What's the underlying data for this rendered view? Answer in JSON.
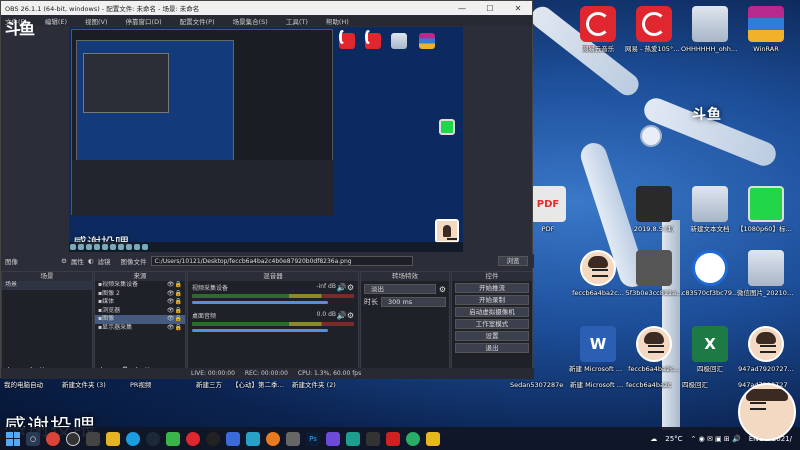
{
  "obs": {
    "title": "OBS 26.1.1 (64-bit, windows) - 配置文件: 未命名 - 场景: 未命名",
    "menu": [
      "文件(F)",
      "编辑(E)",
      "视图(V)",
      "停靠窗口(D)",
      "配置文件(P)",
      "场景集合(S)",
      "工具(T)",
      "帮助(H)"
    ],
    "logo": "斗鱼",
    "preview_caption": "感谢投喂",
    "source_toolbar": {
      "label": "图像",
      "properties": "属性",
      "filters": "滤镜",
      "image_file_label": "图像文件",
      "path": "C:/Users/10121/Desktop/feccb6a4ba2c4b0e87920b0df8236a.png",
      "browse": "浏览"
    },
    "scenes": {
      "title": "场景",
      "items": [
        "场景"
      ]
    },
    "sources": {
      "title": "来源",
      "items": [
        "视频采集设备",
        "图像 2",
        "媒体",
        "浏览器",
        "图像",
        "显示器采集"
      ],
      "selected": 4
    },
    "mixer": {
      "title": "混音器",
      "channels": [
        {
          "name": "视频采集设备",
          "db": "-inf dB"
        },
        {
          "name": "桌面音频",
          "db": "0.0 dB"
        }
      ]
    },
    "transitions": {
      "title": "转场特效",
      "current": "淡出",
      "duration_label": "时长",
      "duration": "300 ms"
    },
    "controls": {
      "title": "控件",
      "buttons": [
        "开始推流",
        "开始录制",
        "启动虚拟摄像机",
        "工作室模式",
        "设置",
        "退出"
      ]
    },
    "status": {
      "live": "LIVE: 00:00:00",
      "rec": "REC: 00:00:00",
      "cpu": "CPU: 1.3%, 60.00 fps"
    }
  },
  "desktop": {
    "wallpaper_text_left": "感谢投喂",
    "wallpaper_logo": "斗鱼",
    "icons": [
      {
        "label": "网易云音乐",
        "kind": "netease"
      },
      {
        "label": "网易 - 热爱105°C的你",
        "kind": "netease"
      },
      {
        "label": "OHHHHHH_ohhh绿幕素材(附教程)",
        "kind": "anime"
      },
      {
        "label": "WinRAR",
        "kind": "rar"
      },
      {
        "label": "PDF",
        "kind": "pdf"
      },
      {
        "label": "2019.8.5 (1)",
        "kind": "game"
      },
      {
        "label": "新建文本文档",
        "kind": "anime"
      },
      {
        "label": "【1080p60】标准绿幕素材免费用!",
        "kind": "green-vid"
      },
      {
        "label": "feccb6a4ba2c...",
        "kind": "avatar"
      },
      {
        "label": "5f3b0e3cc811a...",
        "kind": "cs"
      },
      {
        "label": "c83570cf3bc79...",
        "kind": "circle-logo"
      },
      {
        "label": "微信图片_20210722114...",
        "kind": "anime"
      },
      {
        "label": "新建 Microsoft Word 文档",
        "kind": "word"
      },
      {
        "label": "feccb6a4ba2c...",
        "kind": "avatar"
      },
      {
        "label": "四极回汇",
        "kind": "excel"
      },
      {
        "label": "947ad7920727...",
        "kind": "avatar"
      }
    ],
    "bottom_row_labels": [
      "我的电脑自动",
      "新建文件夹 (3)",
      "PR视频",
      "新建三方",
      "【心动】第二季节奏混剪",
      "新建文件夹 (2)",
      "Sedan5307287e",
      "新建 Microsoft Word 文档",
      "feccb6a4ba2c",
      "四极回汇",
      "947ad7920727"
    ]
  },
  "taskbar": {
    "weather": "25°C",
    "lang": "ENG",
    "time": "2021/"
  }
}
